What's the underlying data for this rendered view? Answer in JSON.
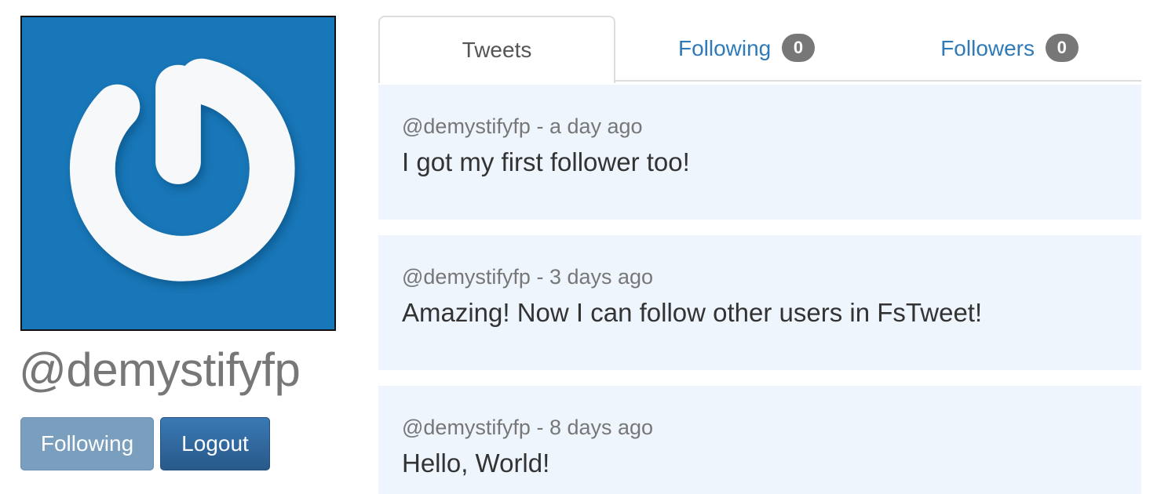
{
  "profile": {
    "username": "@demystifyfp",
    "avatar_icon": "power-icon",
    "avatar_color": "#1877b8",
    "following_button": "Following",
    "logout_button": "Logout"
  },
  "tabs": [
    {
      "label": "Tweets",
      "count": null,
      "active": true
    },
    {
      "label": "Following",
      "count": "0",
      "active": false
    },
    {
      "label": "Followers",
      "count": "0",
      "active": false
    }
  ],
  "tweets": [
    {
      "meta": "@demystifyfp - a day ago",
      "text": "I got my first follower too!"
    },
    {
      "meta": "@demystifyfp - 3 days ago",
      "text": "Amazing! Now I can follow other users in FsTweet!"
    },
    {
      "meta": "@demystifyfp - 8 days ago",
      "text": "Hello, World!"
    }
  ]
}
